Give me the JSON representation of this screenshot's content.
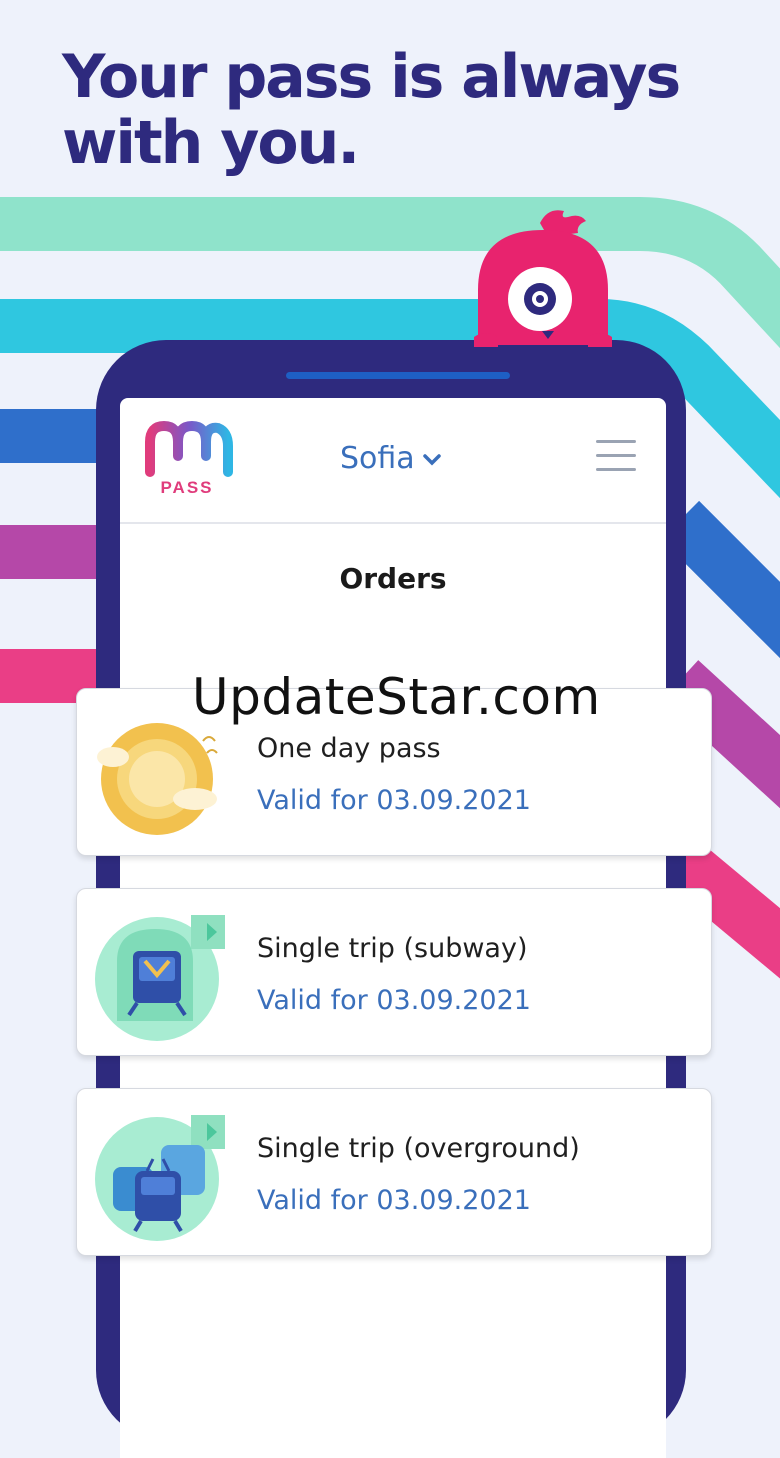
{
  "headline": "Your pass is always\nwith you.",
  "app": {
    "logo_text": "PASS",
    "city": "Sofia",
    "page_title": "Orders"
  },
  "orders": [
    {
      "name": "One day pass",
      "valid": "Valid for 03.09.2021",
      "icon": "sun-icon"
    },
    {
      "name": "Single trip (subway)",
      "valid": "Valid for 03.09.2021",
      "icon": "subway-ticket-icon"
    },
    {
      "name": "Single trip (overground)",
      "valid": "Valid for 03.09.2021",
      "icon": "overground-ticket-icon"
    }
  ],
  "watermark": "UpdateStar.com",
  "colors": {
    "headline": "#2e2a7e",
    "phone_frame": "#2e2a7e",
    "link_blue": "#3a6fbb",
    "brand_pink": "#e03c7c",
    "mascot": "#e8236e"
  }
}
